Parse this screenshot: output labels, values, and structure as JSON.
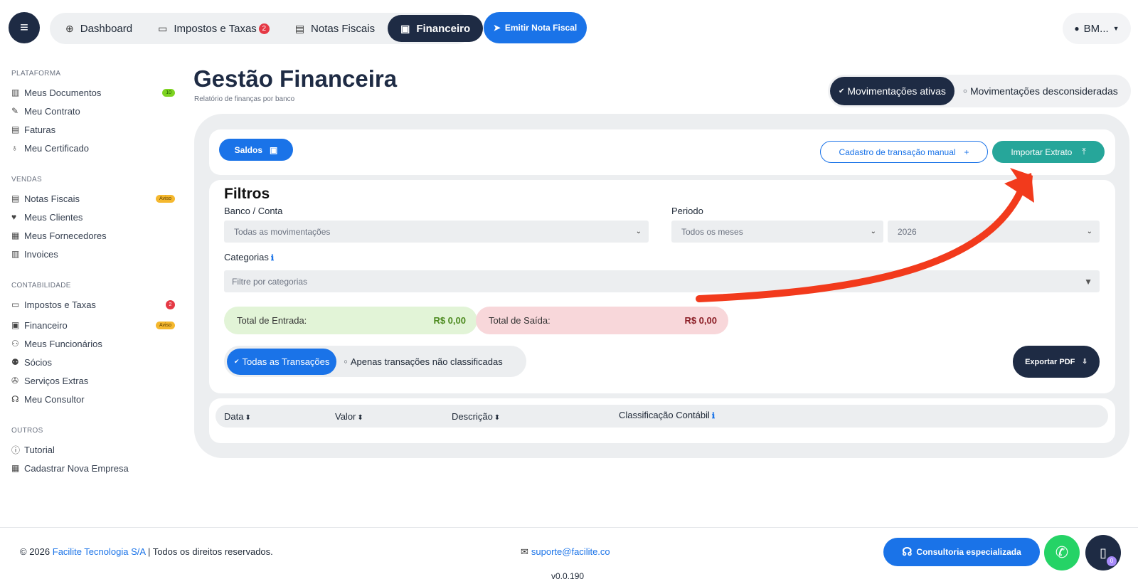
{
  "nav": {
    "tabs": [
      {
        "label": "Dashboard",
        "icon": "globe-icon"
      },
      {
        "label": "Impostos e Taxas",
        "icon": "wallet-icon",
        "badge": "2"
      },
      {
        "label": "Notas Fiscais",
        "icon": "receipt-icon"
      },
      {
        "label": "Financeiro",
        "icon": "money-icon",
        "active": true
      }
    ],
    "emit_label": "Emitir Nota Fiscal",
    "user_label": "BM..."
  },
  "sidebar": {
    "sections": [
      {
        "title": "PLATAFORMA",
        "items": [
          {
            "label": "Meus Documentos",
            "badge": "10"
          },
          {
            "label": "Meu Contrato"
          },
          {
            "label": "Faturas"
          },
          {
            "label": "Meu Certificado"
          }
        ]
      },
      {
        "title": "VENDAS",
        "items": [
          {
            "label": "Notas Fiscais",
            "badge": "Aviso"
          },
          {
            "label": "Meus Clientes"
          },
          {
            "label": "Meus Fornecedores"
          },
          {
            "label": "Invoices"
          }
        ]
      },
      {
        "title": "CONTABILIDADE",
        "items": [
          {
            "label": "Impostos e Taxas",
            "badge": "2"
          },
          {
            "label": "Financeiro",
            "badge": "Aviso"
          },
          {
            "label": "Meus Funcionários"
          },
          {
            "label": "Sócios"
          },
          {
            "label": "Serviços Extras"
          },
          {
            "label": "Meu Consultor"
          }
        ]
      },
      {
        "title": "OUTROS",
        "items": [
          {
            "label": "Tutorial"
          },
          {
            "label": "Cadastrar Nova Empresa"
          }
        ]
      }
    ]
  },
  "page": {
    "title": "Gestão Financeira",
    "subtitle": "Relatório de finanças por banco",
    "mov_active": "Movimentações ativas",
    "mov_ignored": "Movimentações desconsideradas"
  },
  "actions": {
    "saldos": "Saldos",
    "cadastro": "Cadastro de transação manual",
    "importar": "Importar Extrato"
  },
  "filters": {
    "title": "Filtros",
    "banco_label": "Banco / Conta",
    "banco_value": "Todas as movimentações",
    "periodo_label": "Periodo",
    "mes_value": "Todos os meses",
    "ano_value": "2026",
    "categorias_label": "Categorias",
    "categorias_placeholder": "Filtre por categorias"
  },
  "totals": {
    "entrada_label": "Total de Entrada:",
    "entrada_value": "R$ 0,00",
    "saida_label": "Total de Saída:",
    "saida_value": "R$ 0,00"
  },
  "transactions": {
    "all_label": "Todas as Transações",
    "unclassified_label": "Apenas transações não classificadas",
    "export_label": "Exportar PDF"
  },
  "table": {
    "columns": [
      "Data",
      "Valor",
      "Descrição",
      "Classificação Contábil"
    ]
  },
  "footer": {
    "copy_prefix": "© 2026",
    "company": "Facilite Tecnologia S/A",
    "copy_suffix": "| Todos os direitos reservados.",
    "email": "suporte@facilite.co",
    "version": "v0.0.190",
    "consultoria": "Consultoria especializada",
    "doc_count": "0"
  },
  "colors": {
    "primary": "#1a73e8",
    "dark": "#1e2b44",
    "teal": "#26a69a",
    "arrow": "#f23a1c"
  }
}
